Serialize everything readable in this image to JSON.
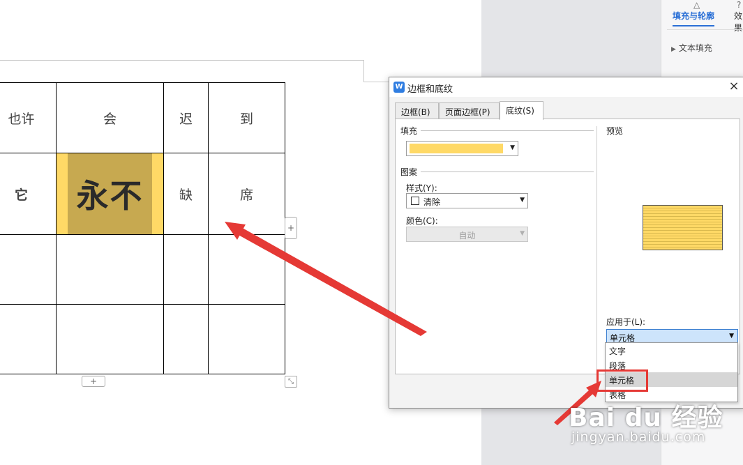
{
  "document": {
    "table": {
      "rows": [
        [
          "也许",
          "会",
          "迟",
          "到"
        ],
        [
          "它",
          "永不",
          "缺",
          "席"
        ],
        [
          "",
          "",
          "",
          ""
        ],
        [
          "",
          "",
          "",
          ""
        ]
      ]
    },
    "add_row_button": "+",
    "add_col_button": "+",
    "resize_handle": "⤡"
  },
  "taskpane": {
    "active_tab": "填充与轮廓",
    "other_tab": "效果",
    "item": "文本填充"
  },
  "dialog": {
    "title": "边框和底纹",
    "close": "×",
    "logo": "W",
    "tabs": [
      "边框(B)",
      "页面边框(P)",
      "底纹(S)"
    ],
    "fill_label": "填充",
    "fill_color": "#ffd966",
    "pattern_label": "图案",
    "style_label": "样式(Y):",
    "style_value": "清除",
    "color_label": "颜色(C):",
    "color_value": "自动",
    "preview_label": "预览",
    "apply_label": "应用于(L):",
    "apply_value": "单元格",
    "apply_options": [
      "文字",
      "段落",
      "单元格",
      "表格"
    ]
  },
  "watermark": {
    "main": "Bai du 经验",
    "sub": "jingyan.baidu.com"
  },
  "colors": {
    "accent_blue": "#2a6fd6",
    "arrow_red": "#e53935",
    "shade_outer": "#ffd966",
    "shade_inner": "#c7a950"
  }
}
